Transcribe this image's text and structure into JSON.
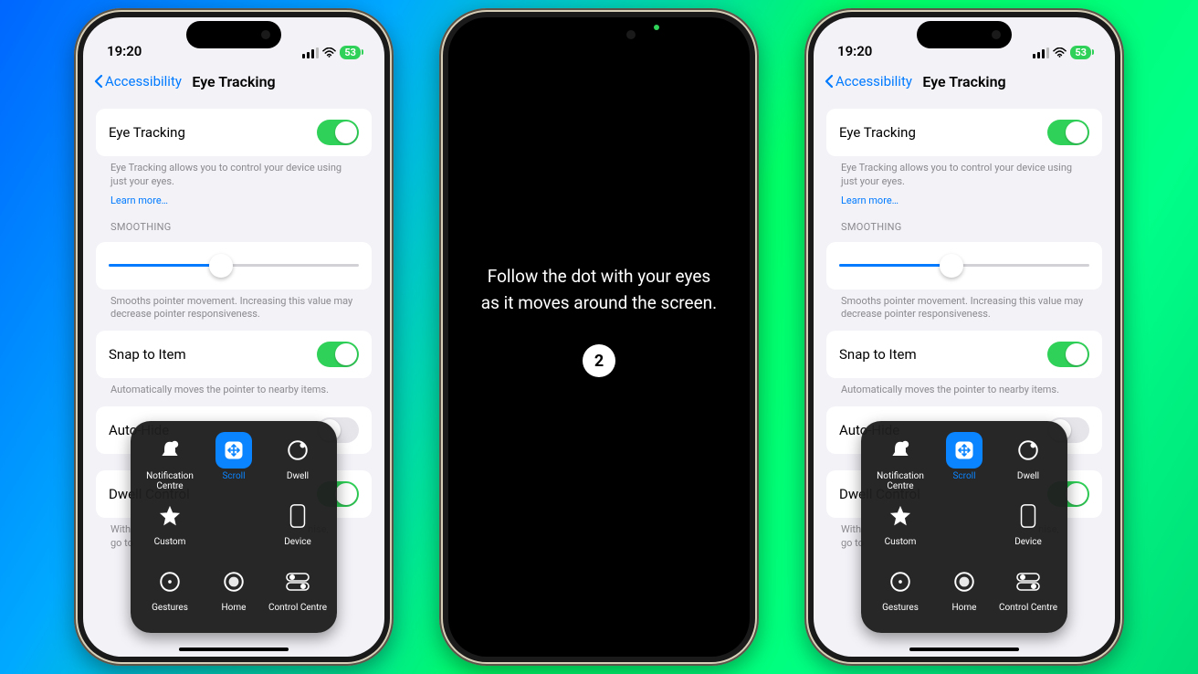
{
  "status": {
    "time": "19:20",
    "battery": "53"
  },
  "nav": {
    "back": "Accessibility",
    "title": "Eye Tracking"
  },
  "eyeTracking": {
    "label": "Eye Tracking",
    "on": true,
    "desc": "Eye Tracking allows you to control your device using just your eyes.",
    "learn": "Learn more…"
  },
  "smoothing": {
    "header": "SMOOTHING",
    "value": 0.45,
    "desc": "Smooths pointer movement. Increasing this value may decrease pointer responsiveness."
  },
  "snap": {
    "label": "Snap to Item",
    "on": true,
    "desc": "Automatically moves the pointer to nearby items."
  },
  "autoHide": {
    "label": "Auto-Hide",
    "on": false
  },
  "dwell": {
    "label": "Dwell Control",
    "on": true,
    "descClipped": "With …                                                                                                                          nise, go to"
  },
  "atMenu": {
    "items": [
      {
        "label": "Notification Centre",
        "icon": "bell"
      },
      {
        "label": "Scroll",
        "icon": "scroll",
        "selected": true
      },
      {
        "label": "Dwell",
        "icon": "dwell"
      },
      {
        "label": "Custom",
        "icon": "star"
      },
      {
        "label": "",
        "icon": ""
      },
      {
        "label": "Device",
        "icon": "device"
      },
      {
        "label": "Gestures",
        "icon": "gestures"
      },
      {
        "label": "Home",
        "icon": "home"
      },
      {
        "label": "Control Centre",
        "icon": "control"
      }
    ]
  },
  "calibration": {
    "line1": "Follow the dot with your eyes",
    "line2": "as it moves around the screen.",
    "count": "2"
  }
}
